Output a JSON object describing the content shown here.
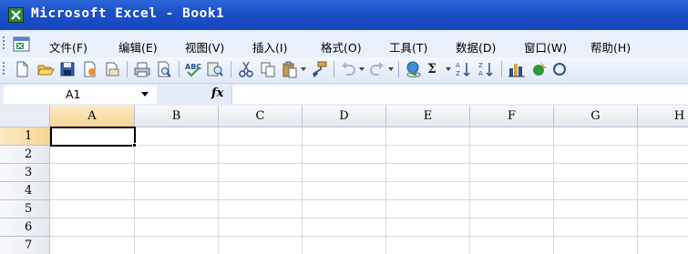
{
  "window": {
    "title": "Microsoft Excel - Book1",
    "title_color": "#1a4ecc"
  },
  "menu": {
    "items": [
      {
        "id": "file",
        "label": "文件(F)"
      },
      {
        "id": "edit",
        "label": "编辑(E)"
      },
      {
        "id": "view",
        "label": "视图(V)"
      },
      {
        "id": "insert",
        "label": "插入(I)"
      },
      {
        "id": "format",
        "label": "格式(O)"
      },
      {
        "id": "tools",
        "label": "工具(T)"
      },
      {
        "id": "data",
        "label": "数据(D)"
      },
      {
        "id": "window",
        "label": "窗口(W)"
      },
      {
        "id": "help",
        "label": "帮助(H)"
      }
    ]
  },
  "toolbar": {
    "buttons": [
      "new-icon",
      "open-icon",
      "save-icon",
      "permission-icon",
      "email-icon",
      "print-icon",
      "print-preview-icon",
      "spelling-icon",
      "research-icon",
      "cut-icon",
      "copy-icon",
      "paste-icon",
      "format-painter-icon",
      "undo-icon",
      "redo-icon",
      "hyperlink-icon",
      "autosum-icon",
      "sort-ascending-icon",
      "sort-descending-icon",
      "chart-wizard-icon",
      "drawing-icon"
    ],
    "autosum_symbol": "Σ"
  },
  "formula_bar": {
    "name_box": "A1",
    "fx_label": "fx",
    "formula": ""
  },
  "grid": {
    "columns": [
      "A",
      "B",
      "C",
      "D",
      "E",
      "F",
      "G",
      "H"
    ],
    "rows": [
      "1",
      "2",
      "3",
      "4",
      "5",
      "6",
      "7"
    ],
    "active_cell": "A1",
    "selection_color": "#f6d597"
  }
}
